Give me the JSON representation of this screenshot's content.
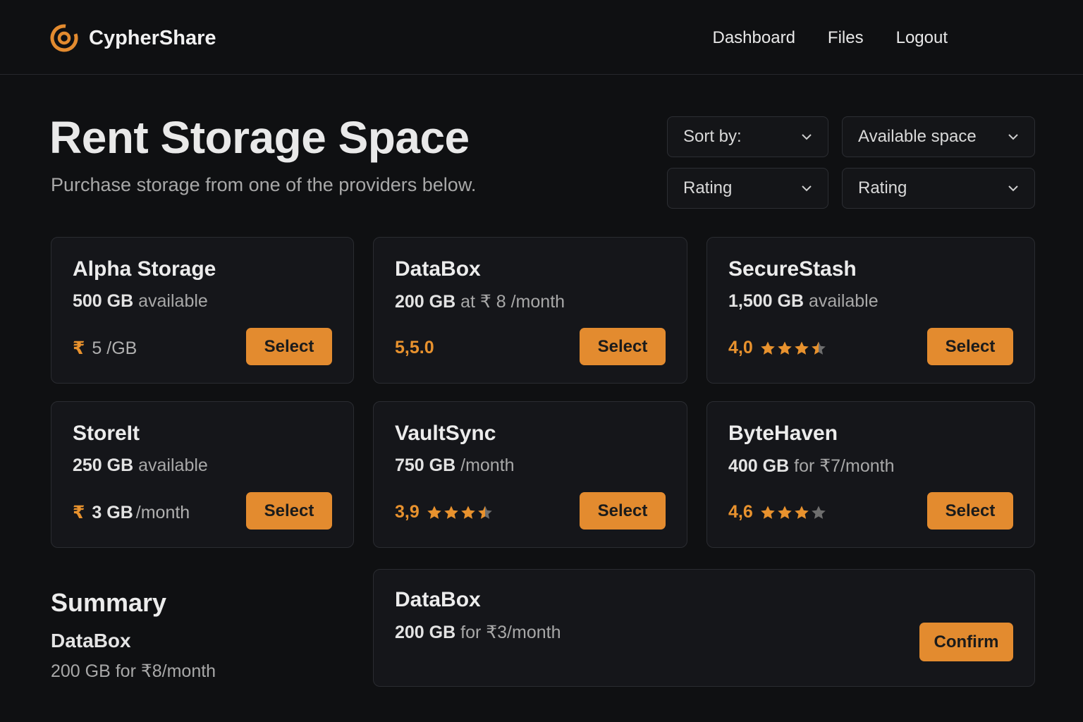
{
  "app": {
    "name": "CypherShare",
    "accent": "#e38b2f"
  },
  "nav": [
    "Dashboard",
    "Files",
    "Logout"
  ],
  "page": {
    "title": "Rent Storage Space",
    "subtitle": "Purchase storage from one of the providers below."
  },
  "filters": {
    "sort_by": "Sort by:",
    "space": "Available space",
    "rating_a": "Rating",
    "rating_b": "Rating"
  },
  "providers": [
    {
      "name": "Alpha Storage",
      "amount": "500 GB",
      "rest": " available",
      "meta_type": "price",
      "currency": "₹",
      "price_bold": "",
      "price_text": " 5 /GB",
      "button": "Select"
    },
    {
      "name": "DataBox",
      "amount": "200 GB",
      "rest": " at ₹ 8 /month",
      "meta_type": "rating",
      "rating_text": "5,5.0",
      "stars": 0,
      "button": "Select"
    },
    {
      "name": "SecureStash",
      "amount": "1,500 GB",
      "rest": " available",
      "meta_type": "rating",
      "rating_text": "4,0",
      "stars": 3.5,
      "button": "Select"
    },
    {
      "name": "StoreIt",
      "amount": "250 GB",
      "rest": " available",
      "meta_type": "price",
      "currency": "₹",
      "price_bold": "3 GB",
      "price_text": " /month",
      "button": "Select"
    },
    {
      "name": "VaultSync",
      "amount": "750 GB",
      "rest": " /month",
      "meta_type": "rating",
      "rating_text": "3,9",
      "stars": 3.5,
      "button": "Select"
    },
    {
      "name": "ByteHaven",
      "amount": "400 GB",
      "rest": " for ₹7/month",
      "meta_type": "rating",
      "rating_text": "4,6",
      "stars": 3,
      "button": "Select"
    }
  ],
  "summary": {
    "title": "Summary",
    "name": "DataBox",
    "detail": "200 GB for ₹8/month"
  },
  "confirm": {
    "name": "DataBox",
    "amount": "200 GB",
    "rest": " for ₹3/month",
    "button": "Confirm"
  }
}
